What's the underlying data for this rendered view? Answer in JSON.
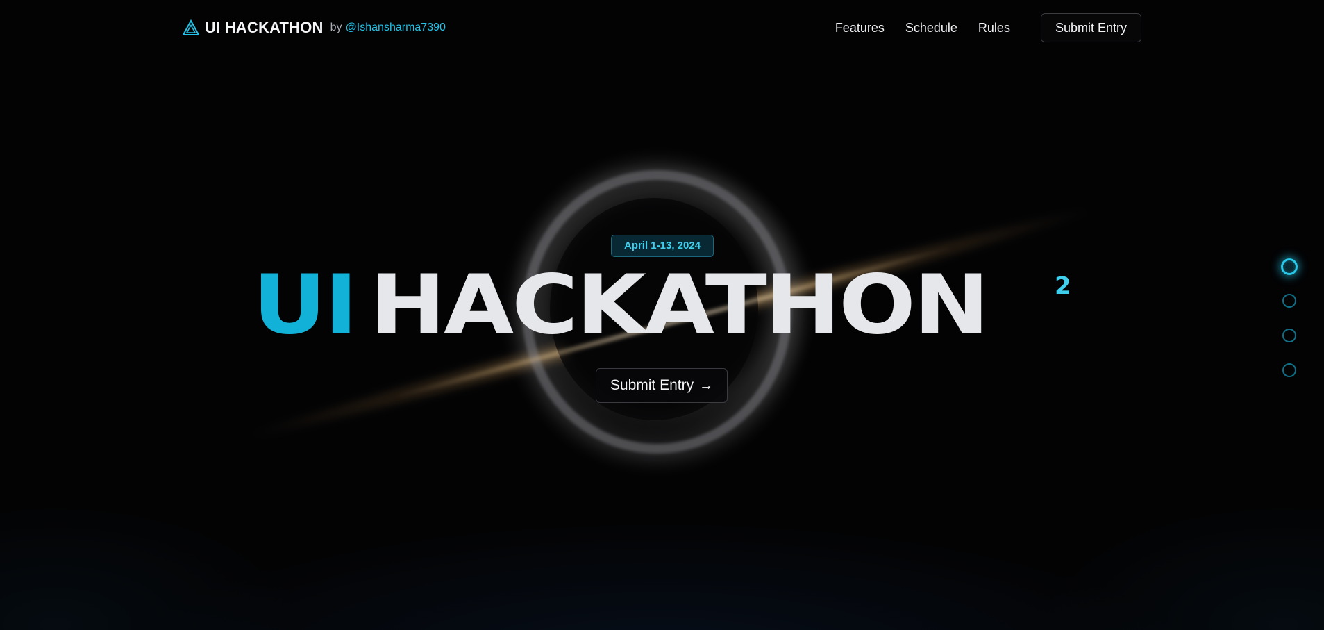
{
  "header": {
    "brand_title": "UI HACKATHON",
    "brand_by": "by",
    "brand_handle": "@Ishansharma7390",
    "nav": [
      "Features",
      "Schedule",
      "Rules"
    ],
    "cta_label": "Submit Entry"
  },
  "hero": {
    "date": "April 1-13, 2024",
    "title_accent": "UI",
    "title_main": "HACKATHON",
    "title_sup": "2",
    "cta_label": "Submit Entry",
    "cta_arrow": "→"
  },
  "side_nav": {
    "count": 4,
    "active_index": 0
  },
  "colors": {
    "accent": "#12b2d8",
    "accent_light": "#3fd0ee",
    "background": "#030304",
    "title_text": "#e6e7ea"
  },
  "icons": {
    "brand_logo": "triangle-logo-icon",
    "cta_arrow": "arrow-right-icon"
  }
}
